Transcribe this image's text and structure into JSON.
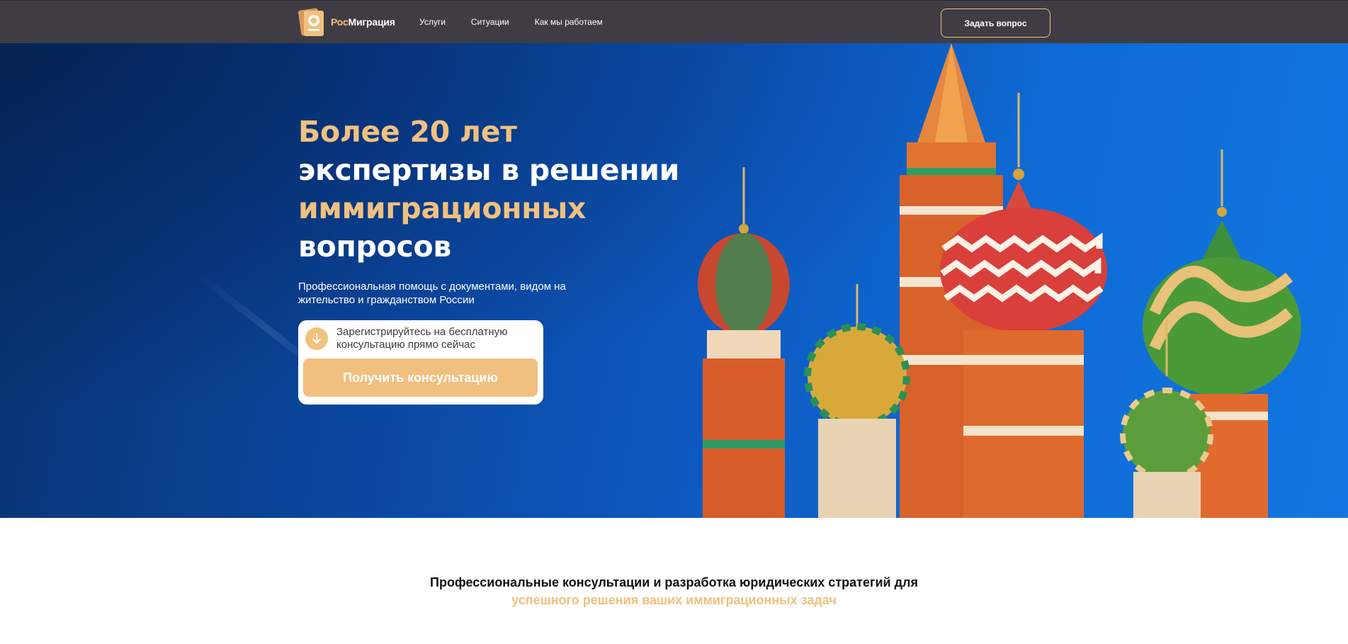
{
  "brand": {
    "name_accent": "Рос",
    "name_rest": "Миграция",
    "accent_color": "#f0c17f",
    "nav_bg_color": "#3f3c44"
  },
  "nav": {
    "links": [
      {
        "label": "Услуги"
      },
      {
        "label": "Ситуации"
      },
      {
        "label": "Как мы работаем"
      }
    ],
    "ask_button": "Задать вопрос"
  },
  "hero": {
    "headline": {
      "line1": "Более 20 лет",
      "line2": "экспертизы в решении",
      "line3": "иммиграционных",
      "line4": "вопросов"
    },
    "subtitle": "Профессиональная помощь с документами, видом на жительство и гражданством России",
    "cta": {
      "icon": "arrow-down-icon",
      "note": "Зарегистрируйтесь на бесплатную консультацию прямо сейчас",
      "button": "Получить консультацию"
    }
  },
  "section": {
    "title_part1": "Профессиональные консультации и разработка юридических стратегий для",
    "title_highlight": "успешного решения ваших иммиграционных задач"
  }
}
